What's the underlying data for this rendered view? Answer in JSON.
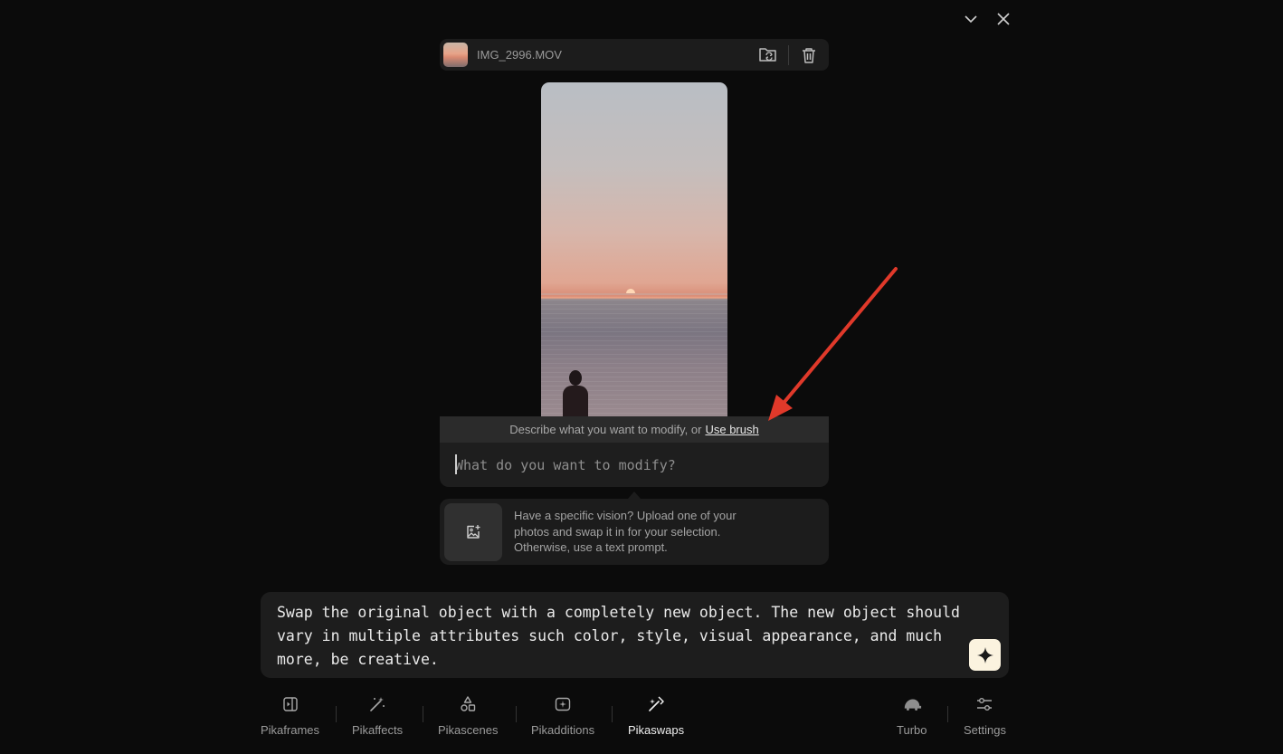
{
  "window_controls": {
    "collapse_icon": "chevron-down-icon",
    "close_icon": "close-icon"
  },
  "file": {
    "name": "IMG_2996.MOV",
    "replace_icon": "folder-swap-icon",
    "delete_icon": "trash-icon"
  },
  "modify": {
    "hint_text": "Describe what you want to modify, or",
    "hint_link": "Use brush",
    "input_value": "",
    "input_placeholder": "What do you want to modify?"
  },
  "upload": {
    "icon": "image-add-icon",
    "description": "Have a specific vision? Upload one of your photos and swap it in for your selection. Otherwise, use a text prompt."
  },
  "prompt": {
    "text": "Swap the original object with a completely new object. The new object should vary in multiple attributes such color, style, visual appearance, and much more, be creative.",
    "generate_icon": "sparkle-icon"
  },
  "tabs": [
    {
      "label": "Pikaframes",
      "icon": "frames-icon",
      "active": false
    },
    {
      "label": "Pikaffects",
      "icon": "magic-wand-icon",
      "active": false
    },
    {
      "label": "Pikascenes",
      "icon": "shapes-icon",
      "active": false
    },
    {
      "label": "Pikadditions",
      "icon": "add-sparkle-icon",
      "active": false
    },
    {
      "label": "Pikaswaps",
      "icon": "swap-wand-icon",
      "active": true
    }
  ],
  "right_tabs": [
    {
      "label": "Turbo",
      "icon": "turtle-icon"
    },
    {
      "label": "Settings",
      "icon": "sliders-icon"
    }
  ],
  "annotation": {
    "color": "#e0392a"
  }
}
